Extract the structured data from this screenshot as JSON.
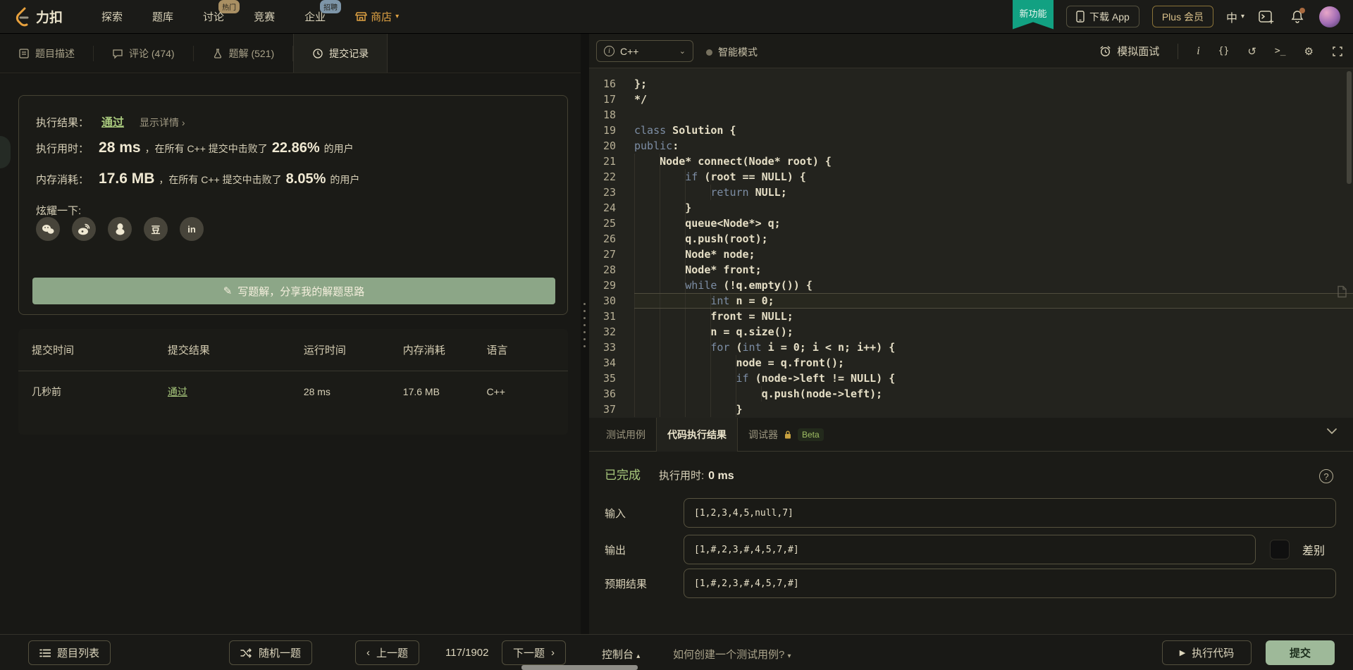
{
  "nav": {
    "logo_text": "力扣",
    "items": [
      {
        "label": "探索"
      },
      {
        "label": "题库"
      },
      {
        "label": "讨论",
        "badge": "热门"
      },
      {
        "label": "竞赛"
      },
      {
        "label": "企业",
        "badge": "招聘"
      },
      {
        "label": "商店"
      }
    ],
    "new_feature": "新功能",
    "download_app": "下载 App",
    "plus_member": "Plus 会员",
    "lang": "中"
  },
  "left_tabs": {
    "description": "题目描述",
    "comments": "评论 (474)",
    "solutions": "题解 (521)",
    "submissions": "提交记录"
  },
  "result_card": {
    "row1": {
      "label": "执行结果：",
      "status": "通过",
      "detail_link": "显示详情 ›"
    },
    "row2": {
      "label": "执行用时：",
      "value": "28 ms",
      "mid": "，在所有 C++ 提交中击败了",
      "pct": "22.86%",
      "suffix": "的用户"
    },
    "row3": {
      "label": "内存消耗：",
      "value": "17.6 MB",
      "mid": "，在所有 C++ 提交中击败了",
      "pct": "8.05%",
      "suffix": "的用户"
    },
    "share_label": "炫耀一下:",
    "douban_glyph": "豆",
    "linkedin_glyph": "in",
    "share_button": "写题解，分享我的解题思路"
  },
  "submissions_table": {
    "headers": [
      "提交时间",
      "提交结果",
      "运行时间",
      "内存消耗",
      "语言"
    ],
    "row": {
      "time": "几秒前",
      "result": "通过",
      "runtime": "28 ms",
      "memory": "17.6 MB",
      "lang": "C++"
    }
  },
  "editor": {
    "language": "C++",
    "smart_mode": "智能模式",
    "mock_interview": "模拟面试",
    "tool_braces": "{}",
    "tool_reset": "↺",
    "tool_terminal": ">_",
    "tool_gear": "⚙",
    "tool_info": "i",
    "current_line": 30,
    "lines": [
      {
        "n": 16,
        "seg": [
          [
            "t",
            "};"
          ]
        ]
      },
      {
        "n": 17,
        "seg": [
          [
            "t",
            "*/"
          ]
        ]
      },
      {
        "n": 18,
        "seg": [
          [
            "t",
            ""
          ]
        ]
      },
      {
        "n": 19,
        "seg": [
          [
            "k",
            "class"
          ],
          [
            "t",
            " Solution {"
          ]
        ]
      },
      {
        "n": 20,
        "seg": [
          [
            "k",
            "public"
          ],
          [
            "t",
            ":"
          ]
        ]
      },
      {
        "n": 21,
        "seg": [
          [
            "t",
            "    Node* connect(Node* root) {"
          ]
        ]
      },
      {
        "n": 22,
        "seg": [
          [
            "t",
            "        "
          ],
          [
            "k",
            "if"
          ],
          [
            "t",
            " (root == NULL) {"
          ]
        ]
      },
      {
        "n": 23,
        "seg": [
          [
            "t",
            "            "
          ],
          [
            "k",
            "return"
          ],
          [
            "t",
            " NULL;"
          ]
        ]
      },
      {
        "n": 24,
        "seg": [
          [
            "t",
            "        }"
          ]
        ]
      },
      {
        "n": 25,
        "seg": [
          [
            "t",
            "        queue<Node*> q;"
          ]
        ]
      },
      {
        "n": 26,
        "seg": [
          [
            "t",
            "        q.push(root);"
          ]
        ]
      },
      {
        "n": 27,
        "seg": [
          [
            "t",
            "        Node* node;"
          ]
        ]
      },
      {
        "n": 28,
        "seg": [
          [
            "t",
            "        Node* front;"
          ]
        ]
      },
      {
        "n": 29,
        "seg": [
          [
            "t",
            "        "
          ],
          [
            "k",
            "while"
          ],
          [
            "t",
            " (!q.empty()) {"
          ]
        ]
      },
      {
        "n": 30,
        "seg": [
          [
            "t",
            "            "
          ],
          [
            "k",
            "int"
          ],
          [
            "t",
            " n = 0;"
          ]
        ]
      },
      {
        "n": 31,
        "seg": [
          [
            "t",
            "            front = NULL;"
          ]
        ]
      },
      {
        "n": 32,
        "seg": [
          [
            "t",
            "            n = q.size();"
          ]
        ]
      },
      {
        "n": 33,
        "seg": [
          [
            "t",
            "            "
          ],
          [
            "k",
            "for"
          ],
          [
            "t",
            " ("
          ],
          [
            "k",
            "int"
          ],
          [
            "t",
            " i = 0; i < n; i++) {"
          ]
        ]
      },
      {
        "n": 34,
        "seg": [
          [
            "t",
            "                node = q.front();"
          ]
        ]
      },
      {
        "n": 35,
        "seg": [
          [
            "t",
            "                "
          ],
          [
            "k",
            "if"
          ],
          [
            "t",
            " (node->left != NULL) {"
          ]
        ]
      },
      {
        "n": 36,
        "seg": [
          [
            "t",
            "                    q.push(node->left);"
          ]
        ]
      },
      {
        "n": 37,
        "seg": [
          [
            "t",
            "                }"
          ]
        ]
      }
    ]
  },
  "console_panel": {
    "tabs": {
      "testcase": "测试用例",
      "result": "代码执行结果",
      "debugger": "调试器",
      "beta": "Beta"
    },
    "status": "已完成",
    "runtime_label": "执行用时:",
    "runtime_value": "0 ms",
    "fields": [
      {
        "label": "输入",
        "value": "[1,2,3,4,5,null,7]"
      },
      {
        "label": "输出",
        "value": "[1,#,2,3,#,4,5,7,#]"
      },
      {
        "label": "预期结果",
        "value": "[1,#,2,3,#,4,5,7,#]"
      }
    ],
    "diff_label": "差别"
  },
  "bottom_bar": {
    "problem_list": "题目列表",
    "random": "随机一题",
    "prev": "上一题",
    "counter": "117/1902",
    "next": "下一题",
    "console": "控制台",
    "help": "如何创建一个测试用例?",
    "run": "执行代码",
    "submit": "提交"
  }
}
